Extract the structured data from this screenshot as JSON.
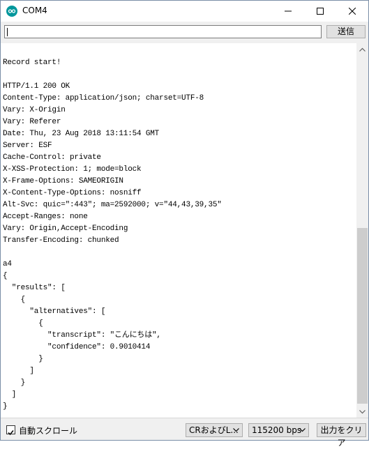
{
  "window": {
    "title": "COM4",
    "minimize_icon": "minimize-icon",
    "maximize_icon": "maximize-icon",
    "close_icon": "close-icon"
  },
  "send_row": {
    "input_value": "",
    "send_label": "送信"
  },
  "output": {
    "lines": [
      "",
      "Record start!",
      "",
      "HTTP/1.1 200 OK",
      "Content-Type: application/json; charset=UTF-8",
      "Vary: X-Origin",
      "Vary: Referer",
      "Date: Thu, 23 Aug 2018 13:11:54 GMT",
      "Server: ESF",
      "Cache-Control: private",
      "X-XSS-Protection: 1; mode=block",
      "X-Frame-Options: SAMEORIGIN",
      "X-Content-Type-Options: nosniff",
      "Alt-Svc: quic=\":443\"; ma=2592000; v=\"44,43,39,35\"",
      "Accept-Ranges: none",
      "Vary: Origin,Accept-Encoding",
      "Transfer-Encoding: chunked",
      "",
      "a4",
      "{",
      "  \"results\": [",
      "    {",
      "      \"alternatives\": [",
      "        {",
      "          \"transcript\": \"こんにちは\",",
      "          \"confidence\": 0.9010414",
      "        }",
      "      ]",
      "    }",
      "  ]",
      "}"
    ]
  },
  "bottom_bar": {
    "autoscroll_label": "自動スクロール",
    "autoscroll_checked": true,
    "line_ending_value": "CRおよびL...",
    "baud_value": "115200 bps",
    "clear_label": "出力をクリア"
  }
}
